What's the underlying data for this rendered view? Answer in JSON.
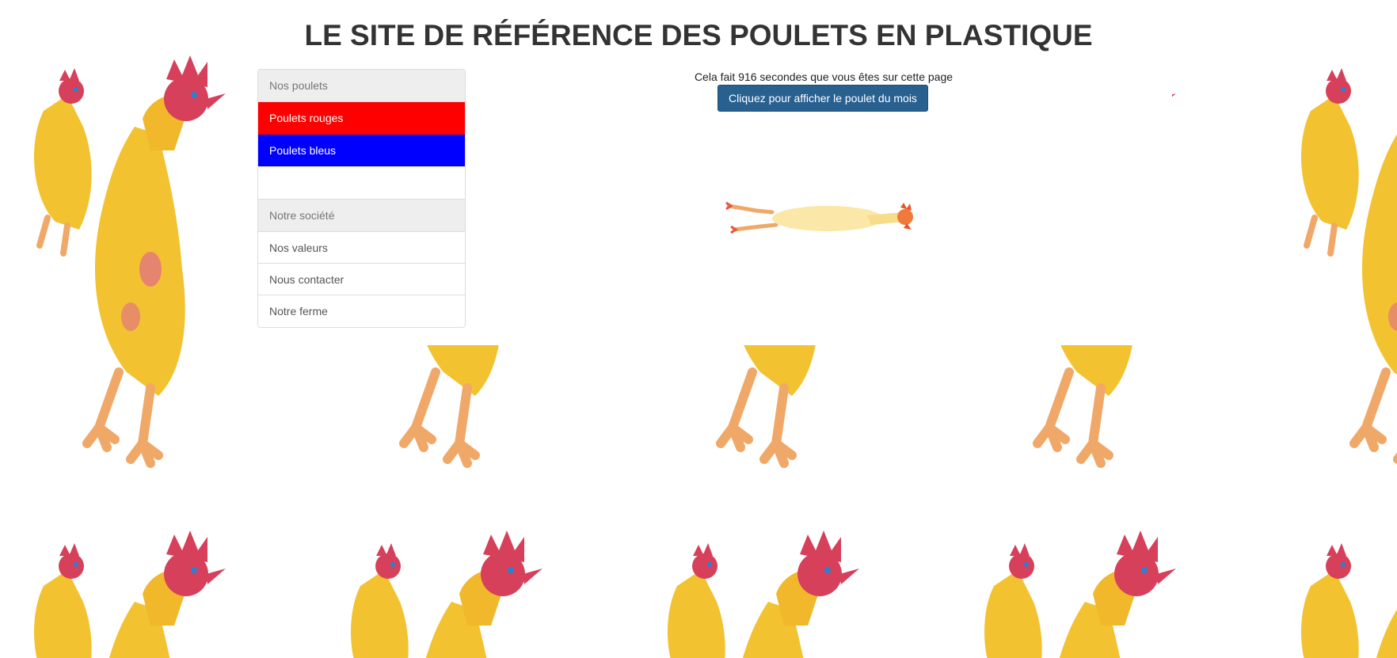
{
  "page": {
    "title": "LE SITE DE RÉFÉRENCE DES POULETS EN PLASTIQUE"
  },
  "menu": {
    "groups": [
      {
        "header": "Nos poulets",
        "items": [
          "Poulets rouges",
          "Poulets bleus",
          ""
        ]
      },
      {
        "header": "Notre société",
        "items": [
          "Nos valeurs",
          "Nous contacter",
          "Notre ferme"
        ]
      }
    ]
  },
  "main": {
    "timer_text": "Cela fait 916 secondes que vous êtes sur cette page",
    "button_label": "Cliquez pour afficher le poulet du mois"
  },
  "colors": {
    "red_item": "#ff0000",
    "blue_item": "#0000ff",
    "button": "#286090",
    "chicken_body": "#f2c230",
    "chicken_comb": "#d6405a"
  },
  "background": {
    "pattern": "rubber-chicken-tile"
  }
}
